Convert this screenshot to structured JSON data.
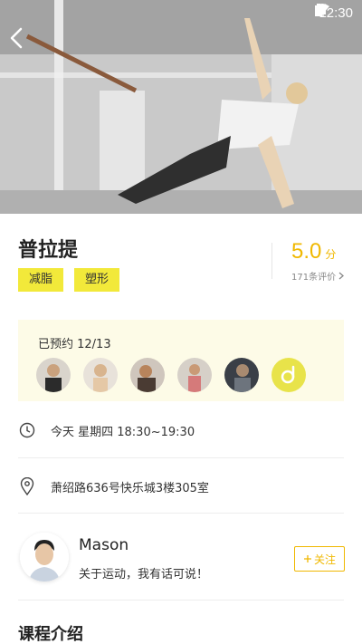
{
  "status_bar": {
    "time": "12:30"
  },
  "course": {
    "title": "普拉提",
    "tags": [
      "减脂",
      "塑形"
    ],
    "rating": {
      "score": "5.0",
      "unit": "分",
      "reviews": "171条评价"
    }
  },
  "booking": {
    "label": "已预约 12/13"
  },
  "schedule": {
    "time": "今天  星期四  18:30~19:30"
  },
  "location": {
    "address": "萧绍路636号快乐城3楼305室"
  },
  "coach": {
    "name": "Mason",
    "bio": "关于运动，我有话可说！",
    "follow_label": "关注"
  },
  "section": {
    "title": "课程介绍"
  },
  "colors": {
    "accent": "#f0b800",
    "tag_bg": "#f2e93a",
    "panel_bg": "#fdfbe7"
  }
}
